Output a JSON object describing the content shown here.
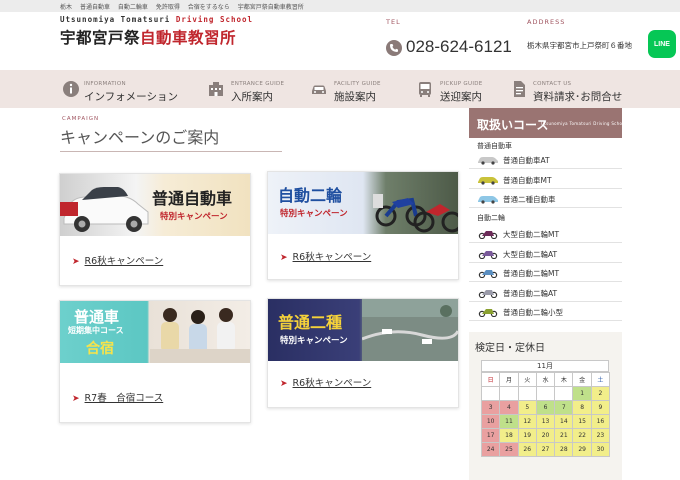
{
  "breadcrumb": [
    "栃木",
    "普通自動車",
    "自動二輪車",
    "免許取得",
    "合宿をするなら",
    "宇都宮戸祭自動車教習所"
  ],
  "logo": {
    "en_main": "Utsunomiya Tomatsuri ",
    "en_accent": "Driving School",
    "jp_main": "宇都宮戸祭",
    "jp_accent": "自動車教習所"
  },
  "contact": {
    "tel_label": "TEL",
    "tel": "028-624-6121",
    "address_label": "ADDRESS",
    "address": "栃木県宇都宮市上戸祭町６番地",
    "line": "LINE"
  },
  "nav": [
    {
      "en": "INFORMATION",
      "jp": "インフォメーション",
      "icon": "info-icon"
    },
    {
      "en": "ENTRANCE GUIDE",
      "jp": "入所案内",
      "icon": "building-icon"
    },
    {
      "en": "FACILITY GUIDE",
      "jp": "施設案内",
      "icon": "car-icon"
    },
    {
      "en": "PICKUP GUIDE",
      "jp": "送迎案内",
      "icon": "bus-icon"
    },
    {
      "en": "CONTACT US",
      "jp": "資料請求･お問合せ",
      "icon": "document-icon"
    }
  ],
  "campaign": {
    "en": "CAMPAIGN",
    "title": "キャンペーンのご案内",
    "cards": [
      {
        "banner_title": "普通自動車",
        "banner_sub": "特別キャンペーン",
        "link": "R6秋キャンペーン"
      },
      {
        "banner_title": "自動二輪",
        "banner_sub": "特別キャンペーン",
        "link": "R6秋キャンペーン"
      },
      {
        "banner_title": "普通車",
        "banner_sub": "短期集中コース",
        "banner_extra": "合宿",
        "link": "R7春　合宿コース"
      },
      {
        "banner_title": "普通二種",
        "banner_sub": "特別キャンペーン",
        "link": "R6秋キャンペーン"
      }
    ]
  },
  "courses": {
    "title": "取扱いコース",
    "en": "Utsunomiya Tomatsuri Driving School",
    "groups": [
      {
        "name": "普通自動車",
        "items": [
          {
            "label": "普通自動車AT",
            "color": "#c8c8c8"
          },
          {
            "label": "普通自動車MT",
            "color": "#c9c23a"
          },
          {
            "label": "普通二種自動車",
            "color": "#8ec7e6"
          }
        ]
      },
      {
        "name": "自動二輪",
        "items": [
          {
            "label": "大型自動二輪MT",
            "color": "#6b2b58"
          },
          {
            "label": "大型自動二輪AT",
            "color": "#7a5a9a"
          },
          {
            "label": "普通自動二輪MT",
            "color": "#5a8ec0"
          },
          {
            "label": "普通自動二輪AT",
            "color": "#9a9aa8"
          },
          {
            "label": "普通自動二輪小型",
            "color": "#8aa030"
          }
        ]
      }
    ]
  },
  "calendar": {
    "title": "検定日・定休日",
    "month": "11月",
    "weekdays": [
      "日",
      "月",
      "火",
      "水",
      "木",
      "金",
      "土"
    ],
    "weeks": [
      [
        "",
        "",
        "",
        "",
        "",
        "1",
        "2"
      ],
      [
        "3",
        "4",
        "5",
        "6",
        "7",
        "8",
        "9"
      ],
      [
        "10",
        "11",
        "12",
        "13",
        "14",
        "15",
        "16"
      ],
      [
        "17",
        "18",
        "19",
        "20",
        "21",
        "22",
        "23"
      ],
      [
        "24",
        "25",
        "26",
        "27",
        "28",
        "29",
        "30"
      ]
    ],
    "colors": {
      "holiday": "#e9a0a0",
      "exam": "#bfe08a",
      "open": "#f2ee8a",
      "blank": "#ffffff"
    },
    "day_types": [
      [
        "blank",
        "blank",
        "blank",
        "blank",
        "blank",
        "exam",
        "open"
      ],
      [
        "holiday",
        "holiday",
        "open",
        "exam",
        "exam",
        "open",
        "open"
      ],
      [
        "holiday",
        "exam",
        "open",
        "open",
        "open",
        "open",
        "open"
      ],
      [
        "holiday",
        "open",
        "open",
        "open",
        "open",
        "open",
        "open"
      ],
      [
        "holiday",
        "holiday",
        "open",
        "open",
        "open",
        "open",
        "open"
      ]
    ]
  }
}
